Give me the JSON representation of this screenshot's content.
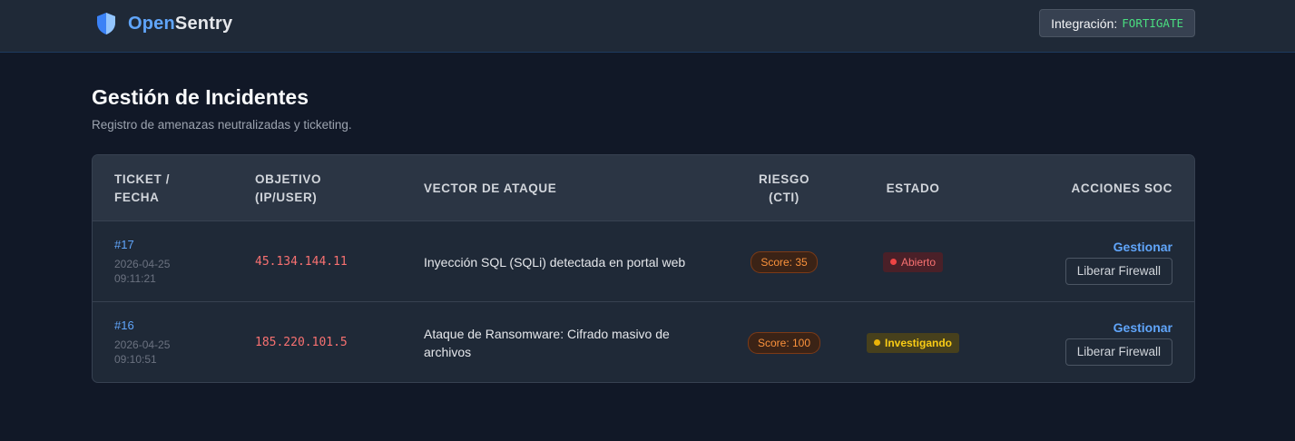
{
  "brand": {
    "name_part1": "Open",
    "name_part2": "Sentry"
  },
  "integration": {
    "label": "Integración:",
    "value": "FORTIGATE"
  },
  "page": {
    "title": "Gestión de Incidentes",
    "subtitle": "Registro de amenazas neutralizadas y ticketing."
  },
  "table": {
    "headers": {
      "ticket": "TICKET /\nFECHA",
      "target": "OBJETIVO\n(IP/USER)",
      "vector": "VECTOR DE ATAQUE",
      "risk": "RIESGO\n(CTI)",
      "status": "ESTADO",
      "actions": "ACCIONES SOC"
    },
    "rows": [
      {
        "id": "#17",
        "date": "2026-04-25",
        "time": "09:11:21",
        "target": "45.134.144.11",
        "vector": "Inyección SQL (SQLi) detectada en portal web",
        "score": "Score: 35",
        "status": "Abierto",
        "manage": "Gestionar",
        "firewall": "Liberar Firewall"
      },
      {
        "id": "#16",
        "date": "2026-04-25",
        "time": "09:10:51",
        "target": "185.220.101.5",
        "vector": "Ataque de Ransomware: Cifrado masivo de archivos",
        "score": "Score: 100",
        "status": "Investigando",
        "manage": "Gestionar",
        "firewall": "Liberar Firewall"
      }
    ]
  },
  "colors": {
    "accent": "#60a5fa",
    "ip": "#f87171",
    "open_status": "#ef4444",
    "investigating_status": "#eab308",
    "integration_code": "#4ade80"
  }
}
